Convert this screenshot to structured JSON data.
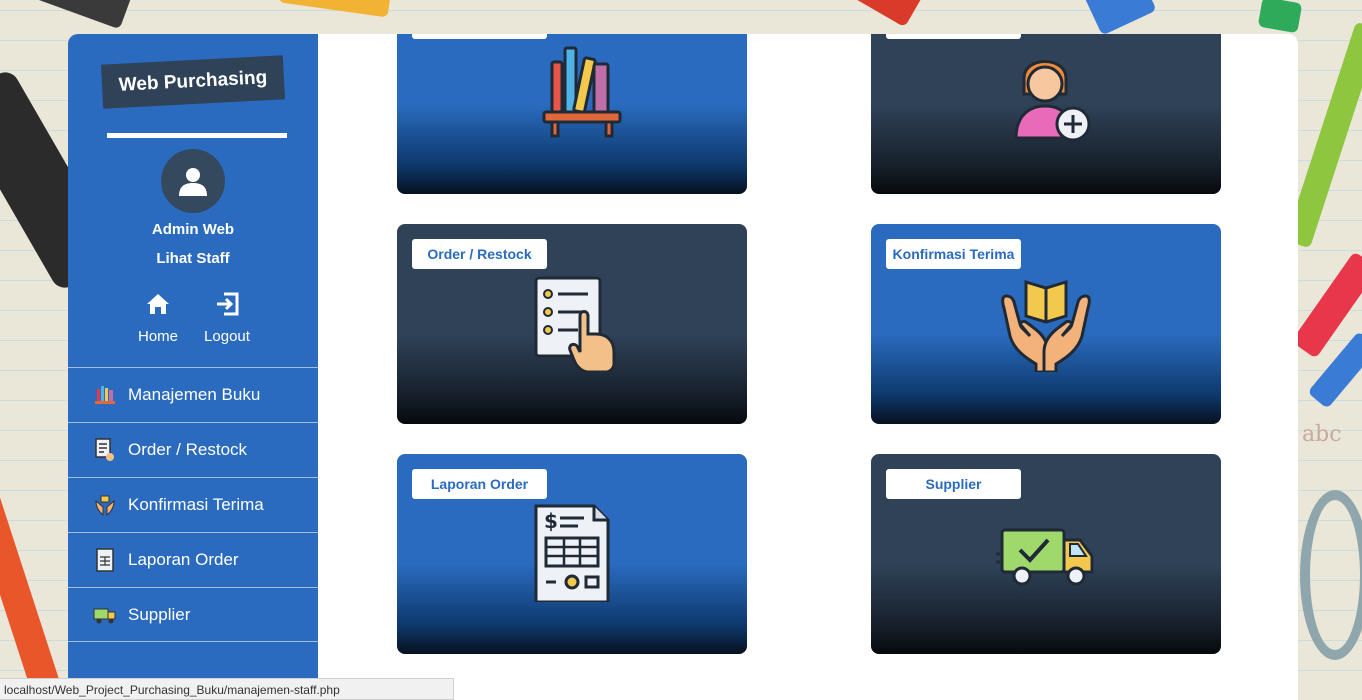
{
  "brand": {
    "title": "Web Purchasing"
  },
  "user": {
    "name": "Admin Web",
    "link": "Lihat Staff"
  },
  "quick_links": {
    "home": "Home",
    "logout": "Logout"
  },
  "menu": [
    {
      "label": "Manajemen Buku",
      "icon": "bookshelf-icon"
    },
    {
      "label": "Order / Restock",
      "icon": "checklist-icon"
    },
    {
      "label": "Konfirmasi Terima",
      "icon": "hands-book-icon"
    },
    {
      "label": "Laporan Order",
      "icon": "invoice-icon"
    },
    {
      "label": "Supplier",
      "icon": "truck-icon"
    }
  ],
  "cards": [
    {
      "label": "",
      "icon": "bookshelf-icon"
    },
    {
      "label": "",
      "icon": "add-user-icon"
    },
    {
      "label": "Order / Restock",
      "icon": "checklist-icon"
    },
    {
      "label": "Konfirmasi Terima",
      "icon": "hands-book-icon"
    },
    {
      "label": "Laporan Order",
      "icon": "invoice-icon"
    },
    {
      "label": "Supplier",
      "icon": "truck-icon"
    }
  ],
  "status_url": "localhost/Web_Project_Purchasing_Buku/manajemen-staff.php",
  "colors": {
    "sidebar": "#2a6bbf",
    "card_blue": "#2a6bbf",
    "card_dark": "#2f4258",
    "label_text": "#2a6bbf"
  }
}
